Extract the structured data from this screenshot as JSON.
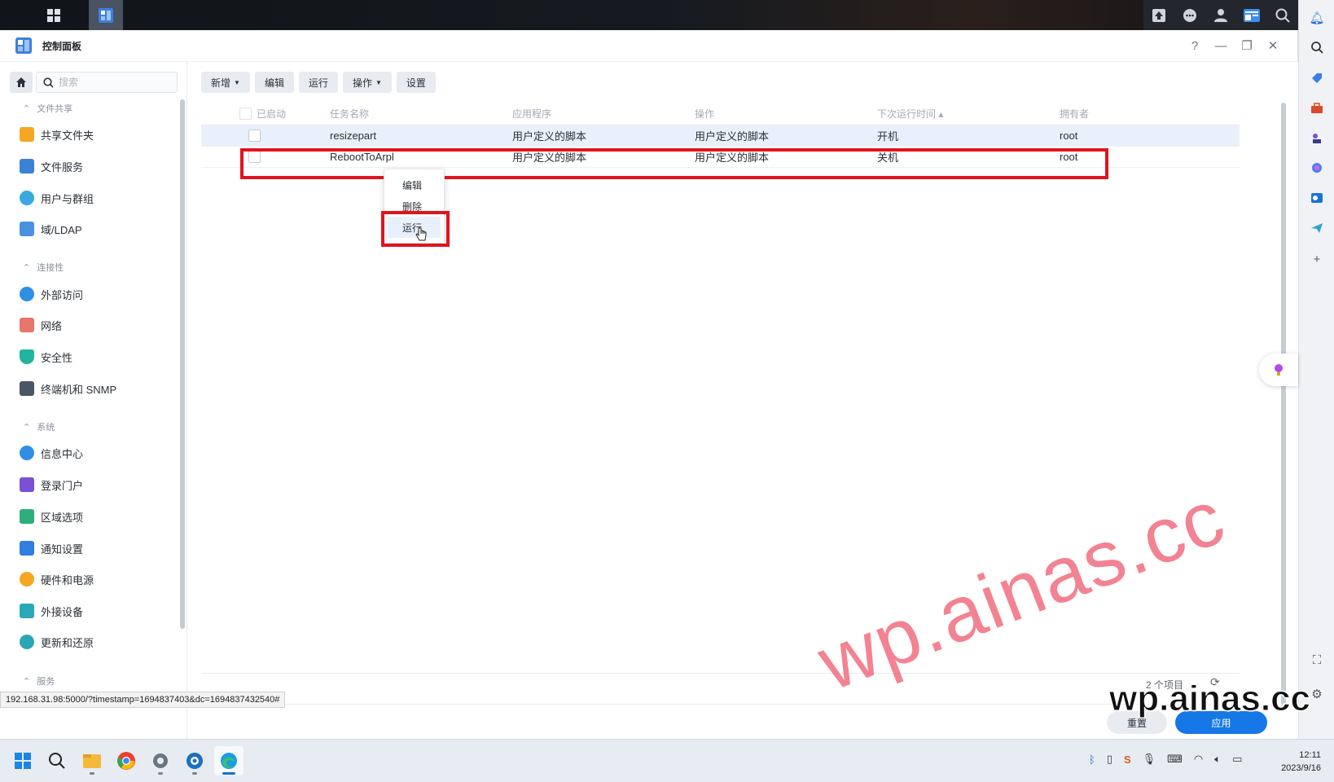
{
  "window": {
    "title": "控制面板"
  },
  "window_controls": {
    "help": "?",
    "minimize": "—",
    "restore": "❐",
    "close": "✕"
  },
  "sidebar": {
    "search_placeholder": "搜索",
    "sections": [
      {
        "label": "文件共享",
        "items": [
          {
            "label": "共享文件夹",
            "icon": "folder-icon"
          },
          {
            "label": "文件服务",
            "icon": "file-services-icon"
          },
          {
            "label": "用户与群组",
            "icon": "users-icon"
          },
          {
            "label": "域/LDAP",
            "icon": "ldap-icon"
          }
        ]
      },
      {
        "label": "连接性",
        "items": [
          {
            "label": "外部访问",
            "icon": "external-access-icon"
          },
          {
            "label": "网络",
            "icon": "network-icon"
          },
          {
            "label": "安全性",
            "icon": "shield-icon"
          },
          {
            "label": "终端机和 SNMP",
            "icon": "terminal-icon"
          }
        ]
      },
      {
        "label": "系统",
        "items": [
          {
            "label": "信息中心",
            "icon": "info-icon"
          },
          {
            "label": "登录门户",
            "icon": "login-portal-icon"
          },
          {
            "label": "区域选项",
            "icon": "region-icon"
          },
          {
            "label": "通知设置",
            "icon": "notification-icon"
          },
          {
            "label": "硬件和电源",
            "icon": "bulb-icon"
          },
          {
            "label": "外接设备",
            "icon": "external-device-icon"
          },
          {
            "label": "更新和还原",
            "icon": "update-icon"
          }
        ]
      },
      {
        "label": "服务",
        "items": []
      }
    ]
  },
  "toolbar": {
    "new": "新增",
    "edit": "编辑",
    "run": "运行",
    "action": "操作",
    "settings": "设置"
  },
  "table": {
    "headers": {
      "enabled": "已启动",
      "task_name": "任务名称",
      "application": "应用程序",
      "action": "操作",
      "next_run": "下次运行时间 ▴",
      "owner": "拥有者"
    },
    "rows": [
      {
        "task_name": "resizepart",
        "application": "用户定义的脚本",
        "action": "用户定义的脚本",
        "next_run": "开机",
        "owner": "root"
      },
      {
        "task_name": "RebootToArpl",
        "application": "用户定义的脚本",
        "action": "用户定义的脚本",
        "next_run": "关机",
        "owner": "root"
      }
    ]
  },
  "context_menu": {
    "items": [
      "编辑",
      "删除",
      "运行"
    ],
    "highlighted": "运行"
  },
  "footer": {
    "item_count": "2 个项目",
    "reset": "重置",
    "apply": "应用"
  },
  "status_url": "192.168.31.98:5000/?timestamp=1694837403&dc=1694837432540#",
  "watermark": {
    "diagonal": "wp.ainas.cc",
    "corner": "wp.ainas.cc"
  },
  "taskbar": {
    "time": "12:11",
    "date": "2023/9/16"
  },
  "colors": {
    "accent": "#1677e6",
    "highlight_box": "#e0141e",
    "selected_row": "#e8f1fb"
  }
}
